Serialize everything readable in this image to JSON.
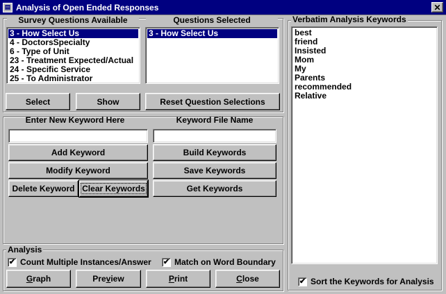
{
  "window": {
    "title": "Analysis of Open Ended Responses",
    "close_glyph": "✕",
    "app_glyph": "▤"
  },
  "survey": {
    "header": "Survey Questions Available",
    "items": [
      "3 - How Select Us",
      "4 - DoctorsSpecialty",
      "6 - Type of Unit",
      "23 - Treatment Expected/Actual",
      "24 - Specific Service",
      "25 - To Administrator"
    ],
    "selected_index": 0
  },
  "selected": {
    "header": "Questions Selected",
    "items": [
      "3 - How Select Us"
    ]
  },
  "question_buttons": {
    "select": "Select",
    "show": "Show",
    "reset": "Reset Question Selections"
  },
  "keyword": {
    "new_header": "Enter New Keyword Here",
    "file_header": "Keyword File Name",
    "new_value": "",
    "file_value": "",
    "add": "Add Keyword",
    "modify": "Modify Keyword",
    "delete": "Delete Keyword",
    "clear": "Clear Keywords",
    "build": "Build Keywords",
    "save": "Save Keywords",
    "get": "Get Keywords"
  },
  "analysis": {
    "legend": "Analysis",
    "count_multiple": {
      "label": "Count Multiple Instances/Answer",
      "checked": true
    },
    "match_boundary": {
      "label": "Match on Word Boundary",
      "checked": true
    },
    "graph_hot": "G",
    "graph_rest": "raph",
    "preview_pre": "Pre",
    "preview_hot": "v",
    "preview_rest": "iew",
    "print_hot": "P",
    "print_rest": "rint",
    "close_hot": "C",
    "close_rest": "lose"
  },
  "verbatim": {
    "legend": "Verbatim Analysis Keywords",
    "keywords": [
      "best",
      "friend",
      "Insisted",
      "Mom",
      "My",
      "Parents",
      "recommended",
      "Relative"
    ],
    "sort": {
      "label": "Sort the Keywords for Analysis",
      "checked": true
    }
  },
  "check_glyph": "✔"
}
